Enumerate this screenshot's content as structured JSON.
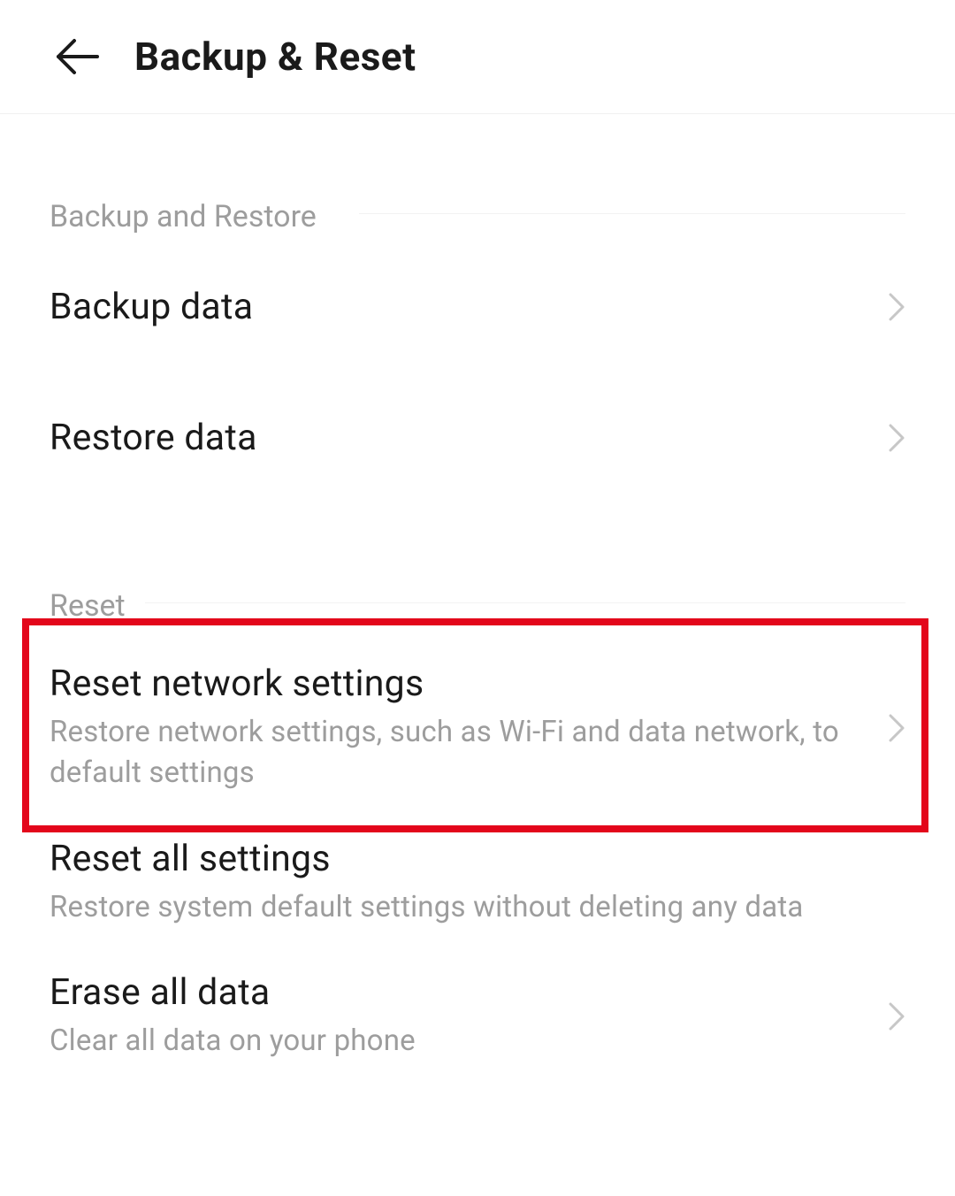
{
  "header": {
    "title": "Backup & Reset"
  },
  "sections": {
    "backup_restore": {
      "header": "Backup and Restore",
      "items": [
        {
          "title": "Backup data"
        },
        {
          "title": "Restore data"
        }
      ]
    },
    "reset": {
      "header": "Reset",
      "items": [
        {
          "title": "Reset network settings",
          "subtitle": "Restore network settings, such as Wi-Fi and data network, to default settings"
        },
        {
          "title": "Reset all settings",
          "subtitle": "Restore system default settings without deleting any data"
        },
        {
          "title": "Erase all data",
          "subtitle": "Clear all data on your phone"
        }
      ]
    }
  }
}
